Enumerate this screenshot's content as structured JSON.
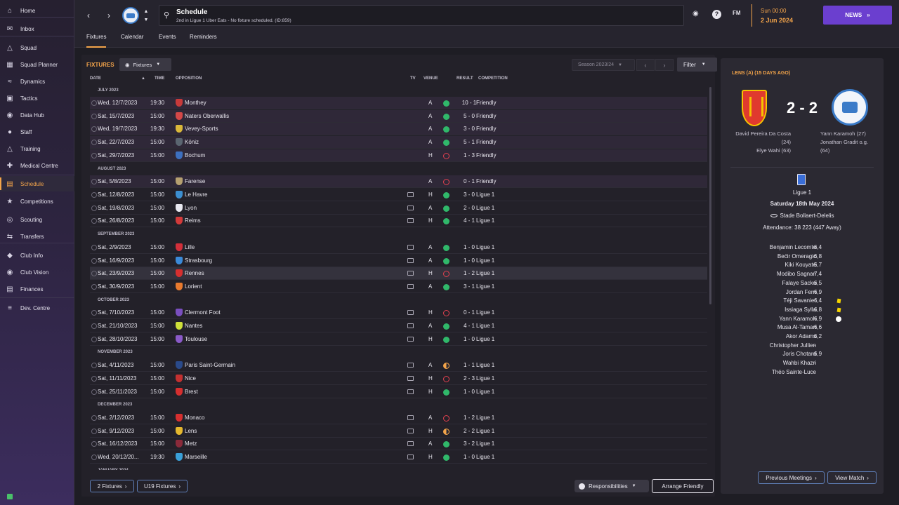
{
  "sidebar": {
    "items": [
      {
        "label": "Home",
        "icon": "home-icon"
      },
      {
        "label": "Inbox",
        "icon": "inbox-icon"
      },
      {
        "label": "Squad",
        "icon": "shirt-icon"
      },
      {
        "label": "Squad Planner",
        "icon": "planner-icon"
      },
      {
        "label": "Dynamics",
        "icon": "dynamics-icon"
      },
      {
        "label": "Tactics",
        "icon": "tactics-icon"
      },
      {
        "label": "Data Hub",
        "icon": "data-hub-icon"
      },
      {
        "label": "Staff",
        "icon": "staff-icon"
      },
      {
        "label": "Training",
        "icon": "training-icon"
      },
      {
        "label": "Medical Centre",
        "icon": "medical-icon"
      },
      {
        "label": "Schedule",
        "icon": "calendar-icon"
      },
      {
        "label": "Competitions",
        "icon": "trophy-icon"
      },
      {
        "label": "Scouting",
        "icon": "scouting-icon"
      },
      {
        "label": "Transfers",
        "icon": "transfers-icon"
      },
      {
        "label": "Club Info",
        "icon": "shield-icon"
      },
      {
        "label": "Club Vision",
        "icon": "vision-icon"
      },
      {
        "label": "Finances",
        "icon": "finances-icon"
      },
      {
        "label": "Dev. Centre",
        "icon": "dev-centre-icon"
      }
    ]
  },
  "header": {
    "title": "Schedule",
    "subtitle": "2nd in Ligue 1 Uber Eats - No fixture scheduled. (ID:859)",
    "time": "Sun 00:00",
    "date": "2 Jun 2024",
    "news_label": "NEWS",
    "fm_label": "FM"
  },
  "tabs": [
    "Fixtures",
    "Calendar",
    "Events",
    "Reminders"
  ],
  "fixtures": {
    "title": "FIXTURES",
    "view_label": "Fixtures",
    "season": "Season 2023/24",
    "filter_label": "Filter",
    "columns": {
      "date": "DATE",
      "time": "TIME",
      "opposition": "OPPOSITION",
      "tv": "TV",
      "venue": "VENUE",
      "result": "RESULT",
      "competition": "COMPETITION"
    },
    "months": [
      "JULY 2023",
      "AUGUST 2023",
      "SEPTEMBER 2023",
      "OCTOBER 2023",
      "NOVEMBER 2023",
      "DECEMBER 2023",
      "JANUARY 2024"
    ],
    "rows": [
      {
        "date": "Wed, 12/7/2023",
        "time": "19:30",
        "opp": "Monthey",
        "venue": "A",
        "outcome": "win",
        "score": "10 - 1",
        "comp": "Friendly",
        "crest": "#c73a3a",
        "tv": false
      },
      {
        "date": "Sat, 15/7/2023",
        "time": "15:00",
        "opp": "Naters Oberwallis",
        "venue": "A",
        "outcome": "win",
        "score": "5 - 0",
        "comp": "Friendly",
        "crest": "#d44848",
        "tv": false
      },
      {
        "date": "Wed, 19/7/2023",
        "time": "19:30",
        "opp": "Vevey-Sports",
        "venue": "A",
        "outcome": "win",
        "score": "3 - 0",
        "comp": "Friendly",
        "crest": "#d9b83a",
        "tv": false
      },
      {
        "date": "Sat, 22/7/2023",
        "time": "15:00",
        "opp": "Köniz",
        "venue": "A",
        "outcome": "win",
        "score": "5 - 1",
        "comp": "Friendly",
        "crest": "#5a6570",
        "tv": false
      },
      {
        "date": "Sat, 29/7/2023",
        "time": "15:00",
        "opp": "Bochum",
        "venue": "H",
        "outcome": "loss",
        "score": "1 - 3",
        "comp": "Friendly",
        "crest": "#3d6fbf",
        "tv": false
      },
      {
        "date": "Sat, 5/8/2023",
        "time": "15:00",
        "opp": "Farense",
        "venue": "A",
        "outcome": "loss",
        "score": "0 - 1",
        "comp": "Friendly",
        "crest": "#b5a070",
        "tv": false
      },
      {
        "date": "Sat, 12/8/2023",
        "time": "15:00",
        "opp": "Le Havre",
        "venue": "H",
        "outcome": "win",
        "score": "3 - 0",
        "comp": "Ligue 1",
        "crest": "#3c8fd0",
        "tv": true
      },
      {
        "date": "Sat, 19/8/2023",
        "time": "15:00",
        "opp": "Lyon",
        "venue": "A",
        "outcome": "win",
        "score": "2 - 0",
        "comp": "Ligue 1",
        "crest": "#e8e8f0",
        "tv": true
      },
      {
        "date": "Sat, 26/8/2023",
        "time": "15:00",
        "opp": "Reims",
        "venue": "H",
        "outcome": "win",
        "score": "4 - 1",
        "comp": "Ligue 1",
        "crest": "#d33a3a",
        "tv": true
      },
      {
        "date": "Sat, 2/9/2023",
        "time": "15:00",
        "opp": "Lille",
        "venue": "A",
        "outcome": "win",
        "score": "1 - 0",
        "comp": "Ligue 1",
        "crest": "#d22f3a",
        "tv": true
      },
      {
        "date": "Sat, 16/9/2023",
        "time": "15:00",
        "opp": "Strasbourg",
        "venue": "A",
        "outcome": "win",
        "score": "1 - 0",
        "comp": "Ligue 1",
        "crest": "#3b8ad8",
        "tv": true
      },
      {
        "date": "Sat, 23/9/2023",
        "time": "15:00",
        "opp": "Rennes",
        "venue": "H",
        "outcome": "loss",
        "score": "1 - 2",
        "comp": "Ligue 1",
        "crest": "#d62f2f",
        "tv": true
      },
      {
        "date": "Sat, 30/9/2023",
        "time": "15:00",
        "opp": "Lorient",
        "venue": "A",
        "outcome": "win",
        "score": "3 - 1",
        "comp": "Ligue 1",
        "crest": "#e87a2e",
        "tv": true
      },
      {
        "date": "Sat, 7/10/2023",
        "time": "15:00",
        "opp": "Clermont Foot",
        "venue": "H",
        "outcome": "loss",
        "score": "0 - 1",
        "comp": "Ligue 1",
        "crest": "#7a4fbf",
        "tv": true
      },
      {
        "date": "Sat, 21/10/2023",
        "time": "15:00",
        "opp": "Nantes",
        "venue": "A",
        "outcome": "win",
        "score": "4 - 1",
        "comp": "Ligue 1",
        "crest": "#cfe03a",
        "tv": true
      },
      {
        "date": "Sat, 28/10/2023",
        "time": "15:00",
        "opp": "Toulouse",
        "venue": "H",
        "outcome": "win",
        "score": "1 - 0",
        "comp": "Ligue 1",
        "crest": "#8a5ac8",
        "tv": true
      },
      {
        "date": "Sat, 4/11/2023",
        "time": "15:00",
        "opp": "Paris Saint-Germain",
        "venue": "A",
        "outcome": "draw",
        "score": "1 - 1",
        "comp": "Ligue 1",
        "crest": "#2a4a8a",
        "tv": true
      },
      {
        "date": "Sat, 11/11/2023",
        "time": "15:00",
        "opp": "Nice",
        "venue": "H",
        "outcome": "loss",
        "score": "2 - 3",
        "comp": "Ligue 1",
        "crest": "#c33030",
        "tv": true
      },
      {
        "date": "Sat, 25/11/2023",
        "time": "15:00",
        "opp": "Brest",
        "venue": "H",
        "outcome": "win",
        "score": "1 - 0",
        "comp": "Ligue 1",
        "crest": "#d62f2f",
        "tv": true
      },
      {
        "date": "Sat, 2/12/2023",
        "time": "15:00",
        "opp": "Monaco",
        "venue": "A",
        "outcome": "loss",
        "score": "1 - 2",
        "comp": "Ligue 1",
        "crest": "#d62f2f",
        "tv": true
      },
      {
        "date": "Sat, 9/12/2023",
        "time": "15:00",
        "opp": "Lens",
        "venue": "H",
        "outcome": "draw",
        "score": "2 - 2",
        "comp": "Ligue 1",
        "crest": "#e5b82e",
        "tv": true
      },
      {
        "date": "Sat, 16/12/2023",
        "time": "15:00",
        "opp": "Metz",
        "venue": "A",
        "outcome": "win",
        "score": "3 - 2",
        "comp": "Ligue 1",
        "crest": "#8a2a3a",
        "tv": true
      },
      {
        "date": "Wed, 20/12/20...",
        "time": "19:30",
        "opp": "Marseille",
        "venue": "H",
        "outcome": "win",
        "score": "1 - 0",
        "comp": "Ligue 1",
        "crest": "#3aa0d8",
        "tv": true
      }
    ],
    "footer": {
      "fixtures_btn": "2 Fixtures",
      "u19_btn": "U19 Fixtures",
      "responsibilities": "Responsibilities",
      "arrange": "Arrange Friendly"
    }
  },
  "match": {
    "title": "LENS (A) (15 DAYS AGO)",
    "score": "2 - 2",
    "home_scorers": [
      "David Pereira Da Costa",
      "(24)",
      "Elye Wahi (63)"
    ],
    "away_scorers": [
      "Yann Karamoh (27)",
      "Jonathan Gradit o.g.",
      "(64)"
    ],
    "competition": "Ligue 1",
    "date": "Saturday 18th May 2024",
    "stadium": "Stade Bollaert-Delelis",
    "attendance": "Attendance: 38 223 (447 Away)",
    "players": [
      {
        "name": "Benjamin Lecomte",
        "rating": "6,4",
        "event": ""
      },
      {
        "name": "Bećir Omeragić",
        "rating": "6,8",
        "event": ""
      },
      {
        "name": "Kiki Kouyaté",
        "rating": "6,7",
        "event": ""
      },
      {
        "name": "Modibo Sagnan",
        "rating": "7,4",
        "event": ""
      },
      {
        "name": "Falaye Sacko",
        "rating": "6,5",
        "event": ""
      },
      {
        "name": "Jordan Ferri",
        "rating": "6,9",
        "event": ""
      },
      {
        "name": "Téji Savanier",
        "rating": "6,4",
        "event": "yellow-card"
      },
      {
        "name": "Issiaga Sylla",
        "rating": "6,8",
        "event": "yellow-card"
      },
      {
        "name": "Yann Karamoh",
        "rating": "6,9",
        "event": "goal"
      },
      {
        "name": "Musa Al-Tamari",
        "rating": "6,6",
        "event": ""
      },
      {
        "name": "Akor Adams",
        "rating": "6,2",
        "event": ""
      },
      {
        "name": "Christopher Jullien",
        "rating": "-",
        "event": ""
      },
      {
        "name": "Joris Chotard",
        "rating": "6,9",
        "event": ""
      },
      {
        "name": "Wahbi Khazri",
        "rating": "-",
        "event": ""
      },
      {
        "name": "Théo Sainte-Luce",
        "rating": "-",
        "event": ""
      }
    ],
    "prev_btn": "Previous Meetings",
    "view_btn": "View Match"
  }
}
